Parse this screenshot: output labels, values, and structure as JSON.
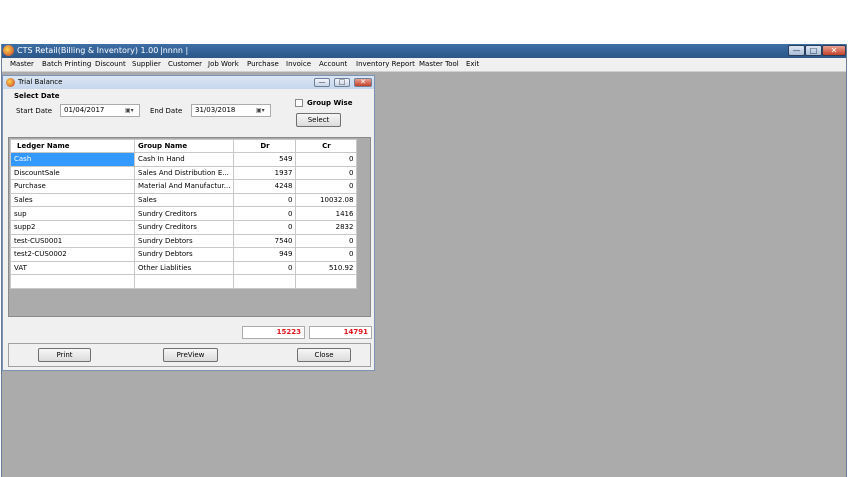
{
  "app": {
    "title": "CTS Retail(Billing & Inventory) 1.00",
    "title_extra": "|nnnn  |",
    "controls": {
      "minimize": "—",
      "maximize": "□",
      "close": "✕"
    }
  },
  "menu": [
    "Master",
    "Batch Printing",
    "Discount",
    "Supplier",
    "Customer",
    "Job Work",
    "Purchase",
    "Invoice",
    "Account",
    "Inventory Report",
    "Master Tool",
    "Exit"
  ],
  "dialog": {
    "title": "Trial Balance",
    "controls": {
      "minimize": "—",
      "maximize": "□",
      "close": "✕"
    },
    "select_date_label": "Select Date",
    "start_date_label": "Start Date",
    "start_date": "01/04/2017",
    "end_date_label": "End Date",
    "end_date": "31/03/2018",
    "group_wise_label": "Group Wise",
    "select_button": "Select",
    "table": {
      "columns": [
        "Ledger Name",
        "Group Name",
        "Dr",
        "Cr"
      ],
      "rows": [
        [
          "Cash",
          "Cash In Hand",
          "549",
          "0"
        ],
        [
          "DiscountSale",
          "Sales And Distribution E...",
          "1937",
          "0"
        ],
        [
          "Purchase",
          "Material And Manufactur...",
          "4248",
          "0"
        ],
        [
          "Sales",
          "Sales",
          "0",
          "10032.08"
        ],
        [
          "sup",
          "Sundry Creditors",
          "0",
          "1416"
        ],
        [
          "supp2",
          "Sundry Creditors",
          "0",
          "2832"
        ],
        [
          "test-CUS0001",
          "Sundry Debtors",
          "7540",
          "0"
        ],
        [
          "test2-CUS0002",
          "Sundry Debtors",
          "949",
          "0"
        ],
        [
          "VAT",
          "Other Liablities",
          "0",
          "510.92"
        ]
      ],
      "selected_row": 0
    },
    "total_dr": "15223",
    "total_cr": "14791",
    "print_button": "Print",
    "preview_button": "PreView",
    "close_button": "Close"
  },
  "colors": {
    "total": "#e0141e",
    "selection": "#3399ff",
    "workspace": "#ababab"
  },
  "icons": [
    "app-logo-icon",
    "calendar-dropdown-icon",
    "checkbox-icon"
  ]
}
